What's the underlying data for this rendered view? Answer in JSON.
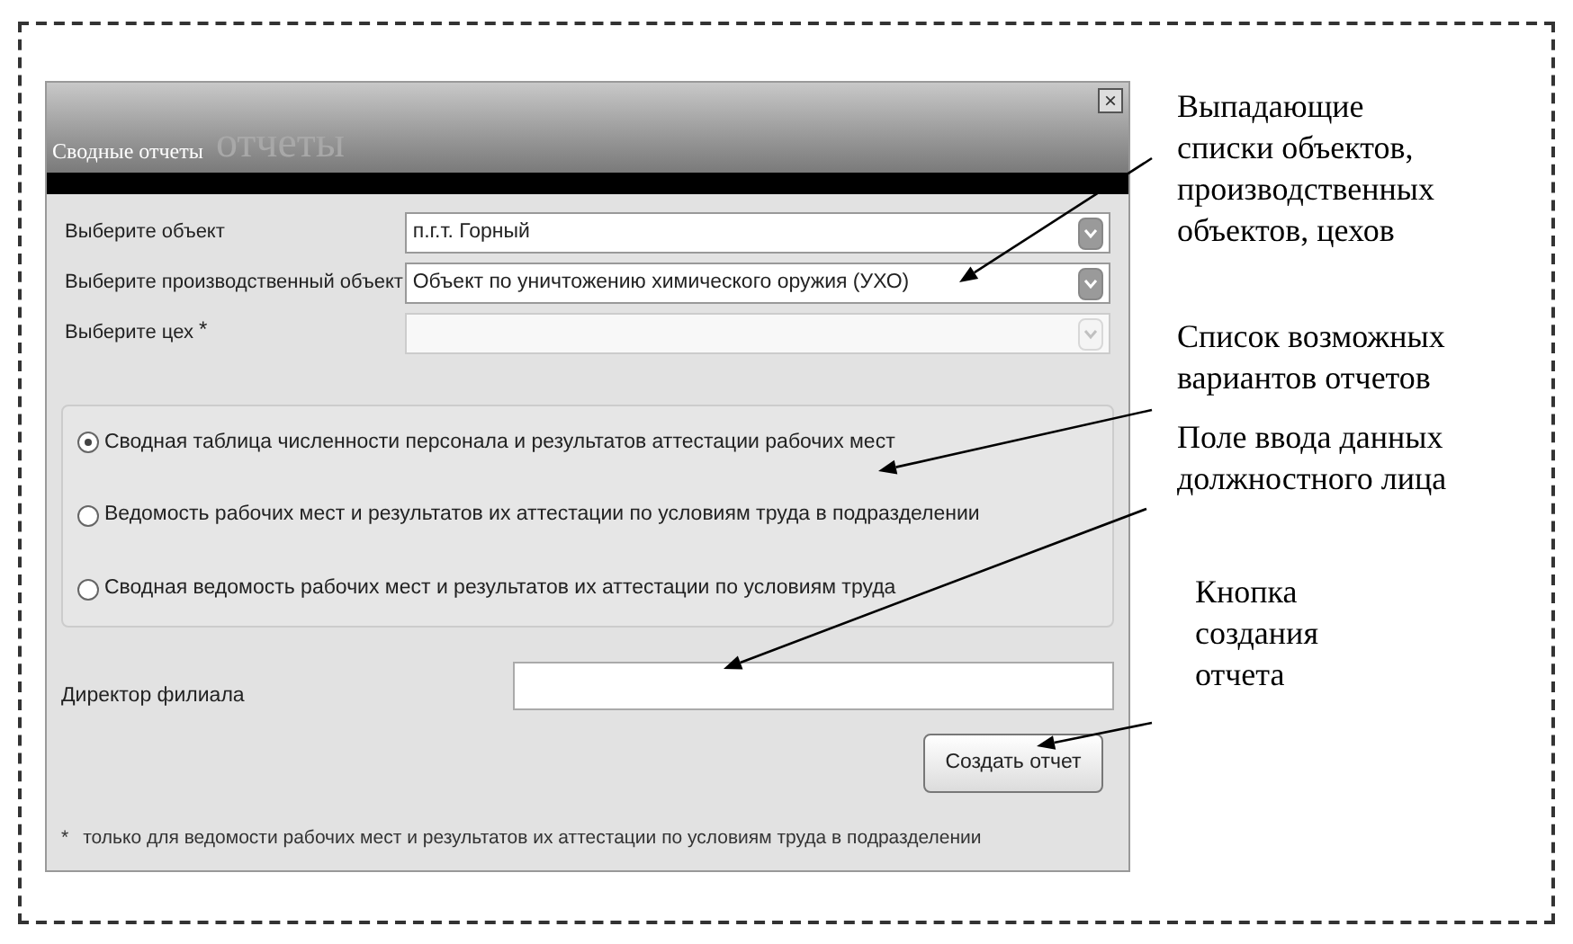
{
  "window": {
    "title": "Сводные отчеты",
    "title_backdrop": "отчеты",
    "close_glyph": "×"
  },
  "selects": [
    {
      "label": "Выберите объект",
      "value": "п.г.т. Горный",
      "disabled": false
    },
    {
      "label": "Выберите производственный объект",
      "value": "Объект по уничтожению химического оружия (УХО)",
      "disabled": false
    },
    {
      "label": "Выберите цех",
      "marker": "*",
      "disabled": true
    }
  ],
  "report_options": [
    {
      "label": "Сводная таблица численности персонала и результатов аттестации рабочих мест",
      "selected": true
    },
    {
      "label": "Ведомость рабочих мест и результатов их аттестации по условиям труда в подразделении",
      "selected": false
    },
    {
      "label": "Сводная ведомость рабочих мест и результатов их аттестации по условиям труда",
      "selected": false
    }
  ],
  "official": {
    "label": "Директор филиала"
  },
  "create_button": "Создать отчет",
  "footnote": {
    "marker": "*",
    "text": "только для ведомости рабочих мест и результатов их аттестации по условиям труда в подразделении"
  },
  "annotations": [
    {
      "text": "Выпадающие списки объектов, производственных объектов, цехов"
    },
    {
      "text": "Список возможных вариантов отчетов"
    },
    {
      "text": "Поле ввода данных должностного лица"
    },
    {
      "text": "Кнопка создания отчета"
    }
  ]
}
